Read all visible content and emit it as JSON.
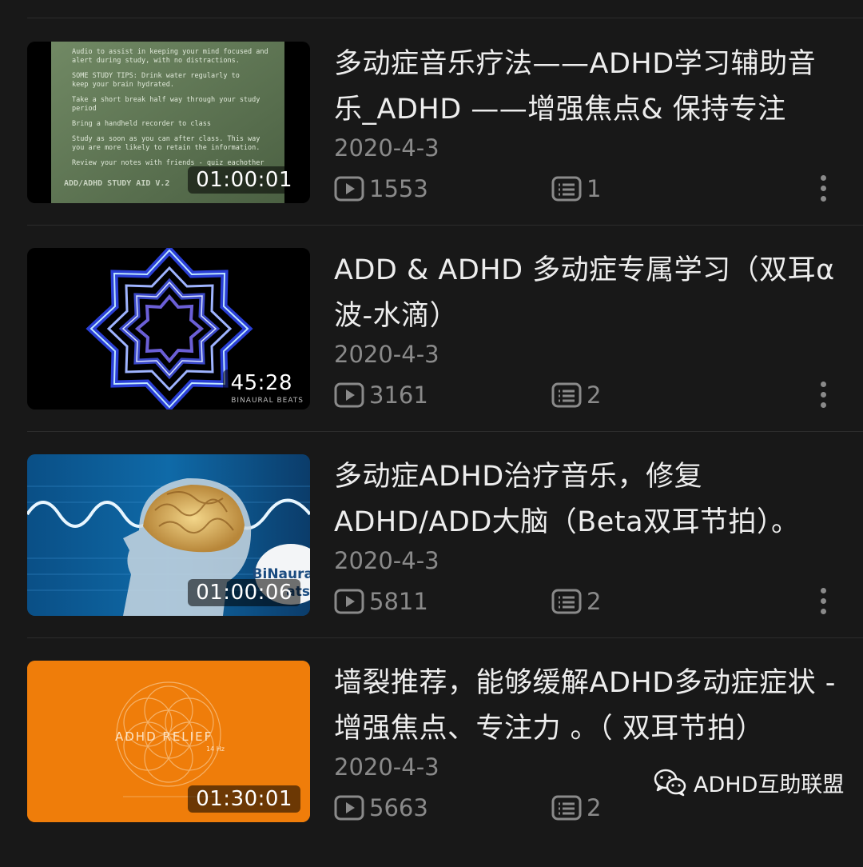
{
  "videos": [
    {
      "title": "多动症音乐疗法——ADHD学习辅助音乐_ADHD ——增强焦点& 保持专注",
      "date": "2020-4-3",
      "views": "1553",
      "comments": "1",
      "duration": "01:00:01",
      "thumb_text": {
        "l1": "Audio to assist in keeping your mind focused and",
        "l2": "alert during study, with no distractions.",
        "l3": "SOME STUDY TIPS: Drink water regularly to",
        "l4": "keep your brain hydrated.",
        "l5": "Take a short break half way through your study",
        "l6": "period",
        "l7": "Bring a handheld recorder to class",
        "l8": "Study as soon as you can after class. This way",
        "l9": "you are more likely to retain the information.",
        "l10": "Review your notes with friends - quiz eachother",
        "footer": "ADD/ADHD STUDY AID V.2"
      }
    },
    {
      "title": "ADD & ADHD 多动症专属学习（双耳α波-水滴）",
      "date": "2020-4-3",
      "views": "3161",
      "comments": "2",
      "duration": "45:28",
      "thumb_text": {
        "brand": "BINAURAL BEATS"
      }
    },
    {
      "title": "多动症ADHD治疗音乐，修复ADHD/ADD大脑（Beta双耳节拍）。",
      "date": "2020-4-3",
      "views": "5811",
      "comments": "2",
      "duration": "01:00:06",
      "thumb_text": {
        "brand": "BiNaura",
        "brand2": "ats"
      }
    },
    {
      "title": "墙裂推荐，能够缓解ADHD多动症症状 - 增强焦点、专注力 。（ 双耳节拍）",
      "date": "2020-4-3",
      "views": "5663",
      "comments": "2",
      "duration": "01:30:01",
      "thumb_text": {
        "title": "ADHD RELIEF",
        "sub": "14 Hz"
      }
    }
  ],
  "watermark": {
    "label": "ADHD互助联盟",
    "icon": "wechat-icon"
  },
  "colors": {
    "background": "#181818",
    "meta": "#8a8a8a",
    "orange": "#ef7d0a"
  }
}
